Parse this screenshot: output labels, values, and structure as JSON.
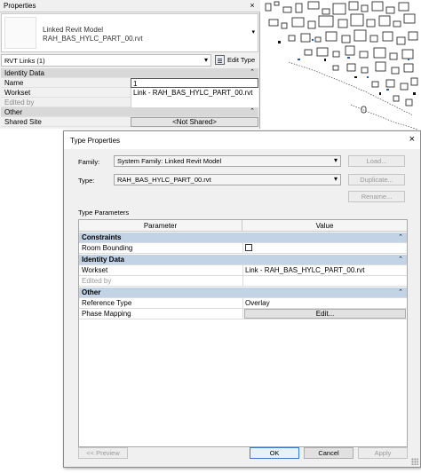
{
  "properties_palette": {
    "title": "Properties",
    "close_glyph": "×",
    "type_selector": {
      "family": "Linked Revit Model",
      "type": "RAH_BAS_HYLC_PART_00.rvt",
      "arrow_glyph": "▾"
    },
    "filter": {
      "label": "RVT Links (1)",
      "arrow_glyph": "▾",
      "edit_type_label": "Edit Type"
    },
    "groups": [
      {
        "name": "Identity Data",
        "rows": [
          {
            "param": "Name",
            "value": "1"
          },
          {
            "param": "Workset",
            "value": "Link - RAH_BAS_HYLC_PART_00.rvt"
          },
          {
            "param": "Edited by",
            "value": ""
          }
        ]
      },
      {
        "name": "Other",
        "rows": [
          {
            "param": "Shared Site",
            "value": "<Not Shared>"
          }
        ]
      }
    ],
    "collapse_glyph": "⌃"
  },
  "dialog": {
    "title": "Type Properties",
    "close_glyph": "×",
    "family_label": "Family:",
    "family_value": "System Family: Linked Revit Model",
    "type_label": "Type:",
    "type_value": "RAH_BAS_HYLC_PART_00.rvt",
    "arrow_glyph": "▾",
    "load_button": "Load...",
    "duplicate_button": "Duplicate...",
    "rename_button": "Rename...",
    "type_parameters_label": "Type Parameters",
    "grid_headers": {
      "parameter": "Parameter",
      "value": "Value"
    },
    "collapse_glyph": "⌃",
    "groups": [
      {
        "name": "Constraints",
        "rows": [
          {
            "param": "Room Bounding",
            "value": "",
            "control": "checkbox",
            "checked": false
          }
        ]
      },
      {
        "name": "Identity Data",
        "rows": [
          {
            "param": "Workset",
            "value": "Link - RAH_BAS_HYLC_PART_00.rvt"
          },
          {
            "param": "Edited by",
            "value": ""
          }
        ]
      },
      {
        "name": "Other",
        "rows": [
          {
            "param": "Reference Type",
            "value": "Overlay"
          },
          {
            "param": "Phase Mapping",
            "value": "Edit...",
            "control": "button"
          }
        ]
      }
    ],
    "preview_button": "<< Preview",
    "ok_button": "OK",
    "cancel_button": "Cancel",
    "apply_button": "Apply"
  },
  "colors": {
    "group_header_blue": "#c3d3e6",
    "palette_group_header": "#d8d8d8",
    "ok_border": "#3a78c9"
  }
}
